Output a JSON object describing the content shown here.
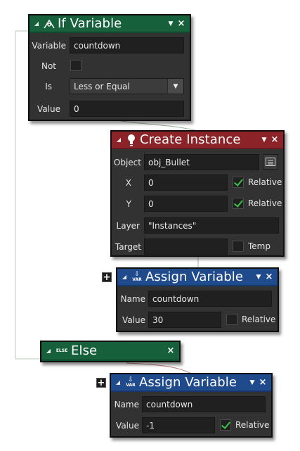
{
  "if_variable": {
    "title": "If Variable",
    "icon": "if-variable-icon",
    "variable_label": "Variable",
    "variable_value": "countdown",
    "not_label": "Not",
    "not_checked": false,
    "is_label": "Is",
    "is_value": "Less or Equal",
    "value_label": "Value",
    "value_value": "0"
  },
  "create_instance": {
    "title": "Create Instance",
    "icon": "lightbulb-icon",
    "object_label": "Object",
    "object_value": "obj_Bullet",
    "x_label": "X",
    "x_value": "0",
    "x_relative": true,
    "y_label": "Y",
    "y_value": "0",
    "y_relative": true,
    "relative_label": "Relative",
    "layer_label": "Layer",
    "layer_value": "\"Instances\"",
    "target_label": "Target",
    "target_value": "",
    "temp_label": "Temp",
    "temp_checked": false
  },
  "assign_variable_1": {
    "title": "Assign Variable",
    "icon": "var-icon",
    "icon_text": "VAR",
    "name_label": "Name",
    "name_value": "countdown",
    "value_label": "Value",
    "value_value": "30",
    "relative_label": "Relative",
    "relative_checked": false
  },
  "else_block": {
    "title": "Else",
    "icon_text": "ELSE"
  },
  "assign_variable_2": {
    "title": "Assign Variable",
    "icon": "var-icon",
    "icon_text": "VAR",
    "name_label": "Name",
    "name_value": "countdown",
    "value_label": "Value",
    "value_value": "-1",
    "relative_label": "Relative",
    "relative_checked": true
  },
  "colors": {
    "header_green": "#16603c",
    "header_red": "#8b2328",
    "header_blue": "#1f4a8c",
    "panel_bg": "#323232",
    "check_green": "#39c14a"
  }
}
